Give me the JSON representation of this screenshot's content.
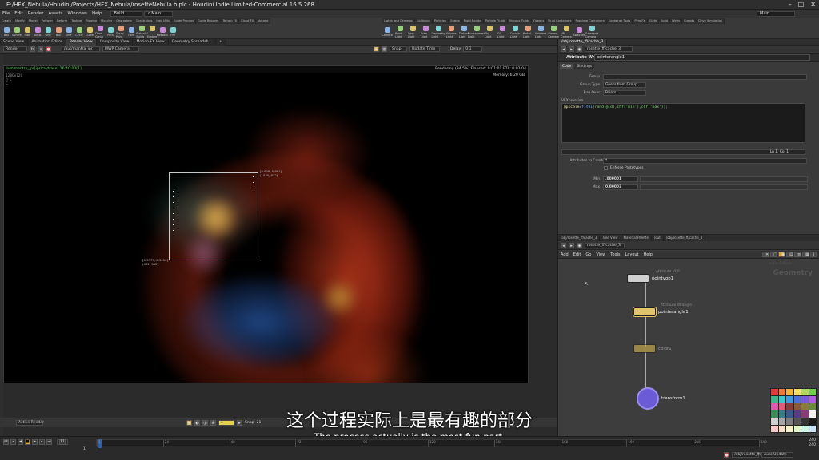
{
  "window": {
    "title": "E:/HFX_Nebula/Houdini/Projects/HFX_Nebula/rosetteNebula.hiplc - Houdini Indie Limited-Commercial 16.5.268"
  },
  "menubar": {
    "items": [
      "File",
      "Edit",
      "Render",
      "Assets",
      "Windows",
      "Help"
    ],
    "desktop": "Build",
    "desktop_right": "Main"
  },
  "shelf": {
    "tabs_left": [
      "Create",
      "Modify",
      "Model",
      "Polygon",
      "Deform",
      "Texture",
      "Rigging",
      "Muscles",
      "Characters",
      "Constraints",
      "Hair Utils",
      "Guide Process",
      "Guide Brushes",
      "Terrain FX",
      "Cloud FX",
      "Volume"
    ],
    "tabs_right": [
      "Lights and Cameras",
      "Collisions",
      "Particles",
      "Grains",
      "Rigid Bodies",
      "Particle Fluids",
      "Viscous Fluids",
      "Oceans",
      "Fluid Containers",
      "Populate Containers",
      "Container Tools",
      "Pyro FX",
      "Cloth",
      "Solid",
      "Wires",
      "Crowds",
      "Drive Simulation"
    ],
    "tools_left": [
      "Box",
      "Sphere",
      "Tube",
      "Torus",
      "Grid",
      "Null",
      "Line",
      "Circle",
      "Curve",
      "Draw Curve",
      "Path",
      "Spray Paint",
      "Font",
      "Platonic Solids",
      "L-System",
      "Metaball",
      "File"
    ],
    "tools_right": [
      "Camera",
      "Point Light",
      "Spot Light",
      "Area Light",
      "Geometry Light",
      "Volume Light",
      "Distant Light",
      "Environment Light",
      "Sky Light",
      "GI Light",
      "Caustic Light",
      "Portal Light",
      "Ambient Light",
      "Stereo Camera",
      "VR Camera",
      "Switcher",
      "Gamepad Camera"
    ]
  },
  "viewport": {
    "tabs": [
      "Scene View",
      "Animation Editor",
      "Render View",
      "Composite View",
      "Motion FX View",
      "Geometry Spreadsh..."
    ],
    "active_tab": "Render View",
    "render_button": "Render",
    "rop_path": "/out/mantra_ipr",
    "camera": "MWP Camera",
    "snap_label": "Snap",
    "update_label": "Update Time",
    "delay_label": "Delay",
    "delay_value": "0.1",
    "header_path": "/out/mantra_ipr[ipr/raytrace] 16:40:03[1]",
    "header_status": "Rendering (94.5%)     Elapsed: 0:01:01     ETA: 0:03:04",
    "memory": "Memory:       6.20 GB",
    "resolution_lines": [
      "1280x720",
      "fr 1",
      "C"
    ],
    "crop_label_tr": "[0.808, 0.661]\n(1035, 832)",
    "crop_label_bl": "[0.3375, 0.3034]\n(432, 382)",
    "bottom_frame": "1",
    "bottom_snap": "Snap",
    "bottom_snap_value": "21",
    "active_render": "Active Render"
  },
  "parameters": {
    "path": "/obj/rosette_ff/cache_3",
    "node_type": "Attribute Wrangle",
    "node_name": "pointerangle1",
    "tabs": [
      "Code",
      "Bindings"
    ],
    "group_label": "Group",
    "group_type_label": "Group Type",
    "group_type_value": "Guess from Group",
    "run_over_label": "Run Over",
    "run_over_value": "Points",
    "vex_label": "VEXpression",
    "vex_code": {
      "var": "@pscale",
      "eq": "=",
      "fn": "fit01",
      "arg": "(rand(@id),chf('min'),chf('max'));"
    },
    "cursor_pos": "Ln 1, Col 1",
    "attributes_to_create_label": "Attributes to Create",
    "attributes_to_create_value": "*",
    "enforce_label": "Enforce Prototypes",
    "min_label": "Min",
    "min_value": ".000001",
    "max_label": "Max",
    "max_value": "0.00003"
  },
  "network": {
    "tabs": [
      "/obj/rosette_ff/cache_3",
      "Tree View",
      "Material Palette",
      "/out",
      "/obj/rosette_ff/cache_3"
    ],
    "path": "rosette_ff/cache_3",
    "menu": [
      "Add",
      "Edit",
      "Go",
      "View",
      "Tools",
      "Layout",
      "Help"
    ],
    "context_label": "Geometry",
    "context_sub": "Indie Edition",
    "nodes": [
      {
        "type": "Attribute VOP",
        "name": "pointvop1",
        "color": "#cfcfcf"
      },
      {
        "type": "Attribute Wrangle",
        "name": "pointerangle1",
        "color": "#e2c46b"
      },
      {
        "type": "",
        "name": "color1",
        "color": "#d9b84f"
      },
      {
        "type": "",
        "name": "transform1",
        "color": "#6b5bd6"
      }
    ]
  },
  "timeline": {
    "frame": "11",
    "start": "1",
    "ticks": [
      "1",
      "24",
      "48",
      "72",
      "96",
      "120",
      "144",
      "168",
      "192",
      "216",
      "240"
    ],
    "end": "240",
    "end2": "240",
    "auto_update": "Auto Update",
    "status_path": "/obj/rosette_ff/cache..."
  },
  "subtitles": {
    "zh": "这个过程实际上是最有趣的部分",
    "en": "The process actually is the most fun part."
  },
  "colors": {
    "accent": "#e8a33b",
    "render_bg": "#000000",
    "panel_bg": "#3a3a3a"
  }
}
